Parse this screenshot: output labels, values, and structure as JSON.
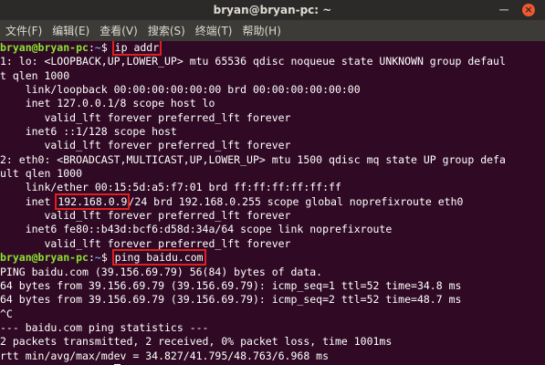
{
  "window": {
    "title": "bryan@bryan-pc: ~",
    "minimize_glyph": "—",
    "close_glyph": "×"
  },
  "menu": [
    "文件(F)",
    "编辑(E)",
    "查看(V)",
    "搜索(S)",
    "终端(T)",
    "帮助(H)"
  ],
  "prompt": {
    "user": "bryan@bryan-pc",
    "sep": ":",
    "path": "~",
    "sign": "$ "
  },
  "lines": [
    {
      "type": "cmd",
      "cmd": "ip addr"
    },
    {
      "type": "out",
      "text": "1: lo: <LOOPBACK,UP,LOWER_UP> mtu 65536 qdisc noqueue state UNKNOWN group defaul"
    },
    {
      "type": "out",
      "text": "t qlen 1000"
    },
    {
      "type": "out",
      "text": "    link/loopback 00:00:00:00:00:00 brd 00:00:00:00:00:00"
    },
    {
      "type": "out",
      "text": "    inet 127.0.0.1/8 scope host lo"
    },
    {
      "type": "out",
      "text": "       valid_lft forever preferred_lft forever"
    },
    {
      "type": "out",
      "text": "    inet6 ::1/128 scope host"
    },
    {
      "type": "out",
      "text": "       valid_lft forever preferred_lft forever"
    },
    {
      "type": "out",
      "text": "2: eth0: <BROADCAST,MULTICAST,UP,LOWER_UP> mtu 1500 qdisc mq state UP group defa"
    },
    {
      "type": "out",
      "text": "ult qlen 1000"
    },
    {
      "type": "out",
      "text": "    link/ether 00:15:5d:a5:f7:01 brd ff:ff:ff:ff:ff:ff"
    },
    {
      "type": "hl",
      "pre": "    inet ",
      "hl": "192.168.0.9",
      "post": "/24 brd 192.168.0.255 scope global noprefixroute eth0"
    },
    {
      "type": "out",
      "text": "       valid_lft forever preferred_lft forever"
    },
    {
      "type": "out",
      "text": "    inet6 fe80::b43d:bcf6:d58d:34a/64 scope link noprefixroute"
    },
    {
      "type": "out",
      "text": "       valid_lft forever preferred_lft forever"
    },
    {
      "type": "cmd",
      "cmd": "ping baidu.com"
    },
    {
      "type": "out",
      "text": "PING baidu.com (39.156.69.79) 56(84) bytes of data."
    },
    {
      "type": "out",
      "text": "64 bytes from 39.156.69.79 (39.156.69.79): icmp_seq=1 ttl=52 time=34.8 ms"
    },
    {
      "type": "out",
      "text": "64 bytes from 39.156.69.79 (39.156.69.79): icmp_seq=2 ttl=52 time=48.7 ms"
    },
    {
      "type": "out",
      "text": "^C"
    },
    {
      "type": "out",
      "text": "--- baidu.com ping statistics ---"
    },
    {
      "type": "out",
      "text": "2 packets transmitted, 2 received, 0% packet loss, time 1001ms"
    },
    {
      "type": "out",
      "text": "rtt min/avg/max/mdev = 34.827/41.795/48.763/6.968 ms"
    },
    {
      "type": "prompt"
    }
  ]
}
